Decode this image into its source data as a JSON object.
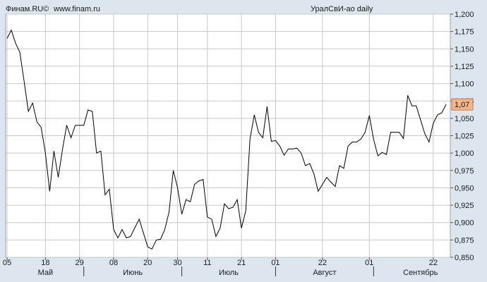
{
  "header": {
    "brand": "Финам.RU©",
    "site": "www.finam.ru",
    "ticker": "УралСвИ-ао daily"
  },
  "chart_data": {
    "type": "line",
    "title": "УралСвИ-ао daily",
    "xlabel": "",
    "ylabel": "",
    "ylim": [
      0.85,
      1.2
    ],
    "grid": true,
    "last_value_label": "1,07",
    "colors": {
      "background": "#dde6ee",
      "plot": "#ffffff",
      "line": "#000000",
      "grid": "#c8c8c8",
      "last_value_box": "#f5b58a"
    },
    "y_ticks": [
      {
        "value": 1.2,
        "label": "1,200"
      },
      {
        "value": 1.175,
        "label": "1,175"
      },
      {
        "value": 1.15,
        "label": "1,150"
      },
      {
        "value": 1.125,
        "label": "1,125"
      },
      {
        "value": 1.1,
        "label": "1,100"
      },
      {
        "value": 1.075,
        "label": "1,075"
      },
      {
        "value": 1.05,
        "label": "1,050"
      },
      {
        "value": 1.025,
        "label": "1,025"
      },
      {
        "value": 1.0,
        "label": "1,000"
      },
      {
        "value": 0.975,
        "label": "0,975"
      },
      {
        "value": 0.95,
        "label": "0,950"
      },
      {
        "value": 0.925,
        "label": "0,925"
      },
      {
        "value": 0.9,
        "label": "0,900"
      },
      {
        "value": 0.875,
        "label": "0,875"
      },
      {
        "value": 0.85,
        "label": "0,850"
      }
    ],
    "x_ticks": [
      {
        "index": 0,
        "label": "05"
      },
      {
        "index": 9,
        "label": "18"
      },
      {
        "index": 17,
        "label": "29"
      },
      {
        "index": 25,
        "label": "08"
      },
      {
        "index": 33,
        "label": "20"
      },
      {
        "index": 40,
        "label": "30"
      },
      {
        "index": 47,
        "label": "11"
      },
      {
        "index": 55,
        "label": "21"
      },
      {
        "index": 63,
        "label": "01"
      },
      {
        "index": 74,
        "label": "22"
      },
      {
        "index": 85,
        "label": "01"
      },
      {
        "index": 100,
        "label": "22"
      }
    ],
    "months": [
      {
        "start": 0,
        "end": 18,
        "label": "Май"
      },
      {
        "start": 18,
        "end": 41,
        "label": "Июнь"
      },
      {
        "start": 41,
        "end": 63,
        "label": "Июль"
      },
      {
        "start": 63,
        "end": 86,
        "label": "Август"
      },
      {
        "start": 86,
        "end": 108,
        "label": "Сентябрь"
      }
    ],
    "series": [
      {
        "values": [
          1.165,
          1.177,
          1.158,
          1.145,
          1.103,
          1.06,
          1.072,
          1.045,
          1.037,
          1.0,
          0.945,
          1.003,
          0.965,
          1.005,
          1.04,
          1.022,
          1.04,
          1.04,
          1.04,
          1.062,
          1.06,
          1.0,
          1.003,
          0.94,
          0.948,
          0.89,
          0.878,
          0.89,
          0.878,
          0.88,
          0.893,
          0.905,
          0.885,
          0.865,
          0.862,
          0.875,
          0.876,
          0.89,
          0.915,
          0.975,
          0.95,
          0.912,
          0.933,
          0.93,
          0.955,
          0.96,
          0.962,
          0.908,
          0.905,
          0.88,
          0.892,
          0.927,
          0.92,
          0.922,
          0.933,
          0.892,
          0.917,
          1.02,
          1.055,
          1.03,
          1.022,
          1.067,
          1.017,
          1.018,
          1.01,
          0.997,
          1.006,
          1.006,
          1.007,
          1.0,
          0.982,
          0.985,
          0.97,
          0.945,
          0.955,
          0.965,
          0.958,
          0.952,
          0.982,
          0.978,
          1.01,
          1.016,
          1.016,
          1.02,
          1.03,
          1.054,
          1.02,
          0.996,
          1.001,
          0.998,
          1.03,
          1.03,
          1.03,
          1.021,
          1.083,
          1.068,
          1.068,
          1.048,
          1.028,
          1.016,
          1.043,
          1.055,
          1.058,
          1.07
        ]
      }
    ]
  }
}
